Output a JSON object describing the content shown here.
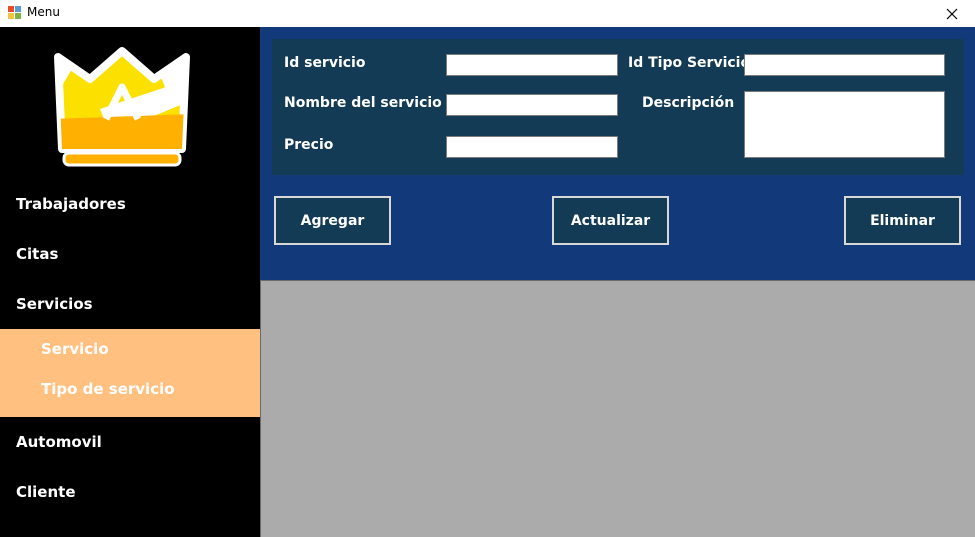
{
  "window": {
    "title": "Menu",
    "icons": {
      "app": "winforms-app-icon",
      "close": "close-icon"
    }
  },
  "sidebar": {
    "logo": "crown-logo",
    "items": [
      {
        "label": "Trabajadores"
      },
      {
        "label": "Citas"
      },
      {
        "label": "Servicios"
      },
      {
        "label": "Automovil"
      },
      {
        "label": "Cliente"
      }
    ],
    "submenu": [
      {
        "label": "Servicio"
      },
      {
        "label": "Tipo de servicio"
      }
    ],
    "colors": {
      "background": "#000000",
      "submenu": "#ffc080",
      "text": "#ffffff"
    }
  },
  "form": {
    "fields": {
      "id_servicio": {
        "label": "Id servicio",
        "value": ""
      },
      "id_tipo_servicio": {
        "label": "Id Tipo Servicio",
        "value": ""
      },
      "nombre_servicio": {
        "label": "Nombre del servicio",
        "value": ""
      },
      "descripcion": {
        "label": "Descripción",
        "value": ""
      },
      "precio": {
        "label": "Precio",
        "value": ""
      }
    },
    "buttons": {
      "agregar": "Agregar",
      "actualizar": "Actualizar",
      "eliminar": "Eliminar"
    },
    "colors": {
      "panel": "#123a7a",
      "form_panel": "#143b55",
      "grid_area": "#ababab"
    }
  }
}
